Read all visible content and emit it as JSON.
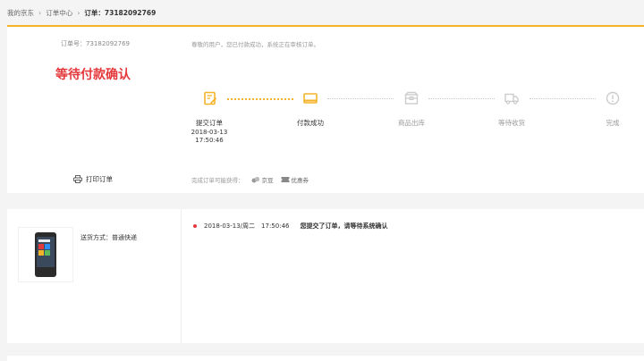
{
  "breadcrumb": {
    "home": "我的京东",
    "orders": "订单中心",
    "current": "订单：73182092769"
  },
  "summary": {
    "order_no": "订单号：73182092769",
    "status": "等待付款确认",
    "notice": "尊敬的用户，您已付款成功，系统正在审核订单。",
    "print_label": "打印订单",
    "gain_label": "完成订单可能获得：",
    "gain_beans": "京豆",
    "gain_coupon": "优惠券"
  },
  "steps": [
    {
      "label": "提交订单",
      "date": "2018-03-13",
      "time": "17:50:46",
      "state": "done"
    },
    {
      "label": "付款成功",
      "state": "current"
    },
    {
      "label": "商品出库",
      "state": "pending"
    },
    {
      "label": "等待收货",
      "state": "pending"
    },
    {
      "label": "完成",
      "state": "pending"
    }
  ],
  "detail": {
    "shipping": "送货方式：普通快递",
    "track_time": "2018-03-13/周二　17:50:46",
    "track_msg": "您提交了订单，请等待系统确认"
  },
  "colors": {
    "accent": "#f5b32a",
    "alert": "#e4393c"
  }
}
